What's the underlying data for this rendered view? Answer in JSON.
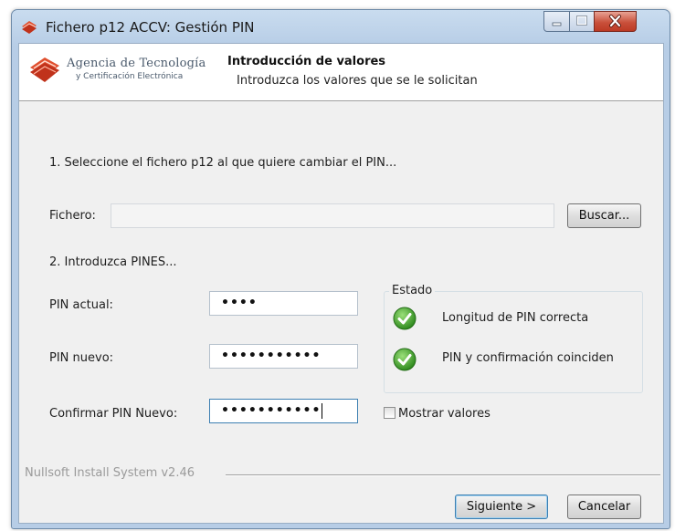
{
  "window": {
    "title": "Fichero p12 ACCV: Gestión PIN"
  },
  "header": {
    "logo_line1": "Agencia de Tecnología",
    "logo_line2": "y Certificación Electrónica",
    "title": "Introducción de valores",
    "subtitle": "Introduzca los valores que se le solicitan"
  },
  "step1": {
    "label": "1. Seleccione el fichero p12 al que quiere cambiar el PIN...",
    "file_label": "Fichero:",
    "file_value": "",
    "browse_label": "Buscar..."
  },
  "step2": {
    "label": "2. Introduzca PINES...",
    "current_pin_label": "PIN actual:",
    "current_pin_value": "••••",
    "new_pin_label": "PIN nuevo:",
    "new_pin_value": "•••••••••••",
    "confirm_pin_label": "Confirmar PIN Nuevo:",
    "confirm_pin_value": "•••••••••••"
  },
  "status": {
    "group_label": "Estado",
    "length_ok": "Longitud de PIN correcta",
    "match_ok": "PIN y confirmación coinciden",
    "icon": "green-checkmark-icon"
  },
  "show_values": {
    "label": "Mostrar valores",
    "checked": false
  },
  "footer": {
    "branding": "Nullsoft Install System v2.46",
    "next_label": "Siguiente >",
    "cancel_label": "Cancelar"
  },
  "colors": {
    "accent_red": "#d9391f",
    "check_green": "#3a9a2a",
    "default_button_border": "#3c7fb1"
  }
}
